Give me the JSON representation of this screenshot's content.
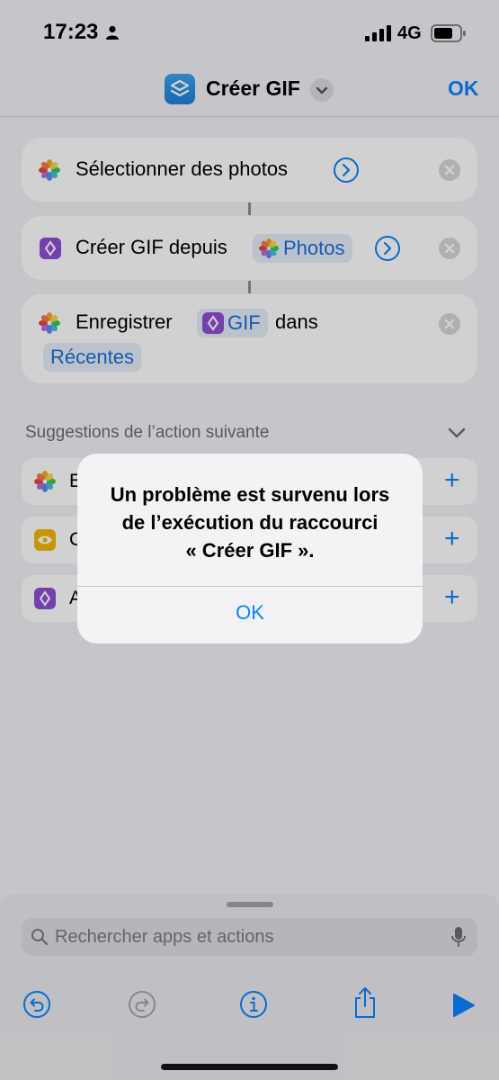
{
  "status": {
    "time": "17:23",
    "network": "4G"
  },
  "nav": {
    "title": "Créer GIF",
    "ok": "OK"
  },
  "actions": {
    "select": {
      "label": "Sélectionner des photos"
    },
    "create": {
      "label": "Créer GIF depuis",
      "pill": "Photos"
    },
    "save": {
      "label": "Enregistrer",
      "pill": "GIF",
      "after": "dans",
      "album": "Récentes"
    }
  },
  "suggestions": {
    "header": "Suggestions de l’action suivante",
    "rows": [
      {
        "initial": "E",
        "icon": "photos-icon"
      },
      {
        "initial": "C",
        "icon": "eye-icon"
      },
      {
        "initial": "A",
        "icon": "shortcuts-icon"
      }
    ]
  },
  "alert": {
    "line1": "Un problème est survenu lors",
    "line2": "de l’exécution du raccourci",
    "line3": "« Créer GIF ».",
    "ok": "OK"
  },
  "bottom": {
    "search_placeholder": "Rechercher apps et actions"
  },
  "colors": {
    "accent": "#0a84ff",
    "purple": "#8e4fd4",
    "yellow": "#f2b705"
  }
}
